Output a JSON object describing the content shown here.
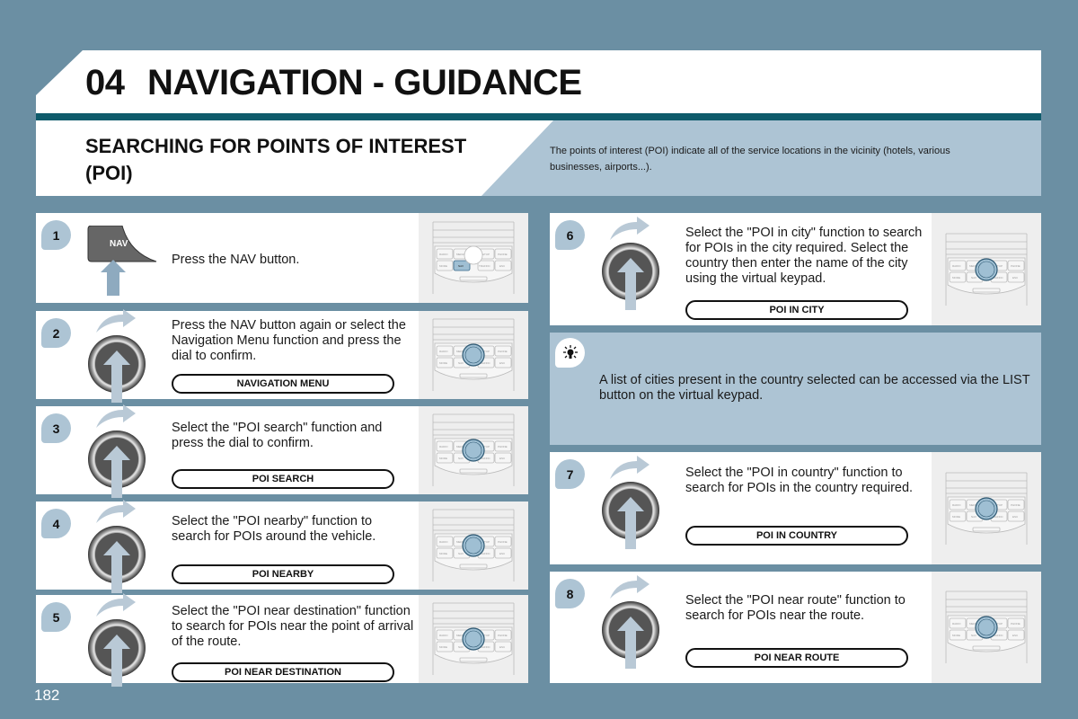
{
  "header": {
    "chapter": "04",
    "title": "NAVIGATION - GUIDANCE"
  },
  "section": {
    "title": "SEARCHING FOR POINTS OF INTEREST (POI)",
    "intro": "The points of interest (POI) indicate all of the service locations in the vicinity (hotels, various businesses, airports...)."
  },
  "steps": [
    {
      "number": "1",
      "text": "Press the NAV button.",
      "key_label": "NAV",
      "icon": "nav-button-press-icon"
    },
    {
      "number": "2",
      "text": "Press the NAV button again or select the Navigation Menu function and press the dial to confirm.",
      "menu": "NAVIGATION MENU",
      "icon": "rotary-dial-icon"
    },
    {
      "number": "3",
      "text": "Select the \"POI search\" function and press the dial to confirm.",
      "menu": "POI SEARCH",
      "icon": "rotary-dial-icon"
    },
    {
      "number": "4",
      "text": "Select the \"POI nearby\" function to search for POIs around the vehicle.",
      "menu": "POI NEARBY",
      "icon": "rotary-dial-icon"
    },
    {
      "number": "5",
      "text": "Select the \"POI near destination\" function to search for POIs near the point of arrival of the route.",
      "menu": "POI NEAR DESTINATION",
      "icon": "rotary-dial-icon"
    },
    {
      "number": "6",
      "text": "Select the \"POI in city\" function to search for POIs in the city required. Select the country then enter the name of the city using the virtual keypad.",
      "menu": "POI IN CITY",
      "icon": "rotary-dial-icon"
    },
    {
      "number": "7",
      "text": "Select the \"POI in country\" function to search for POIs in the country required.",
      "menu": "POI IN COUNTRY",
      "icon": "rotary-dial-icon"
    },
    {
      "number": "8",
      "text": "Select the \"POI near route\" function to search for POIs near the route.",
      "menu": "POI NEAR ROUTE",
      "icon": "rotary-dial-icon"
    }
  ],
  "tip": {
    "icon": "lightbulb-icon",
    "text": "A list of cities present in the country selected can be accessed via the LIST button on the virtual keypad."
  },
  "panel_keys": [
    "RADIO",
    "MEDIA",
    "SETUP",
    "PHONE",
    "MODE",
    "NAV",
    "TRAFFIC",
    "ESC"
  ],
  "footer": {
    "page_number": "182"
  },
  "colors": {
    "background": "#6b8fa3",
    "accent_teal": "#0f5b6b",
    "light_blue": "#adc4d4",
    "highlight": "#9fbfd3"
  }
}
